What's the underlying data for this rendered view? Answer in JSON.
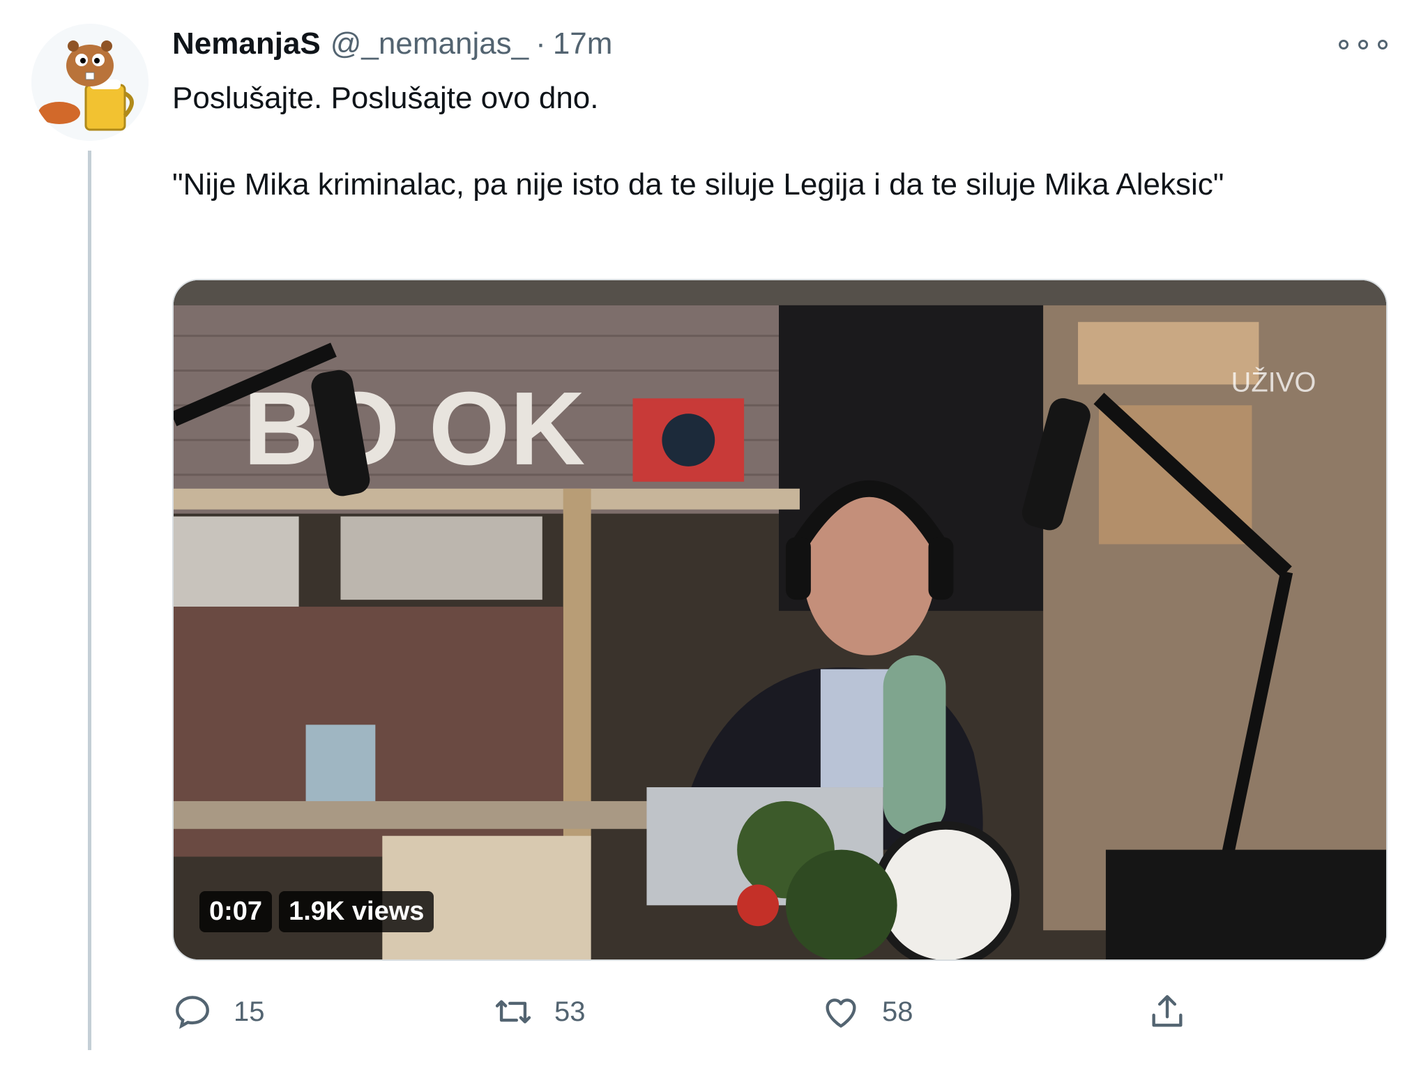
{
  "author": {
    "display_name": "NemanjaS",
    "handle": "@_nemanjas_",
    "separator": "·",
    "time": "17m",
    "avatar_icon": "beaver-beer-mug-avatar"
  },
  "tweet": {
    "line1": "Poslušajte. Poslušajte ovo dno.",
    "line2": "\"Nije Mika kriminalac, pa nije isto da te siluje Legija i da te siluje Mika Aleksic\""
  },
  "media": {
    "type": "video",
    "duration": "0:07",
    "views": "1.9K views"
  },
  "actions": {
    "reply_count": "15",
    "retweet_count": "53",
    "like_count": "58"
  },
  "colors": {
    "text": "#0f1419",
    "secondary": "#536471",
    "thread_line": "#c4cfd6"
  }
}
